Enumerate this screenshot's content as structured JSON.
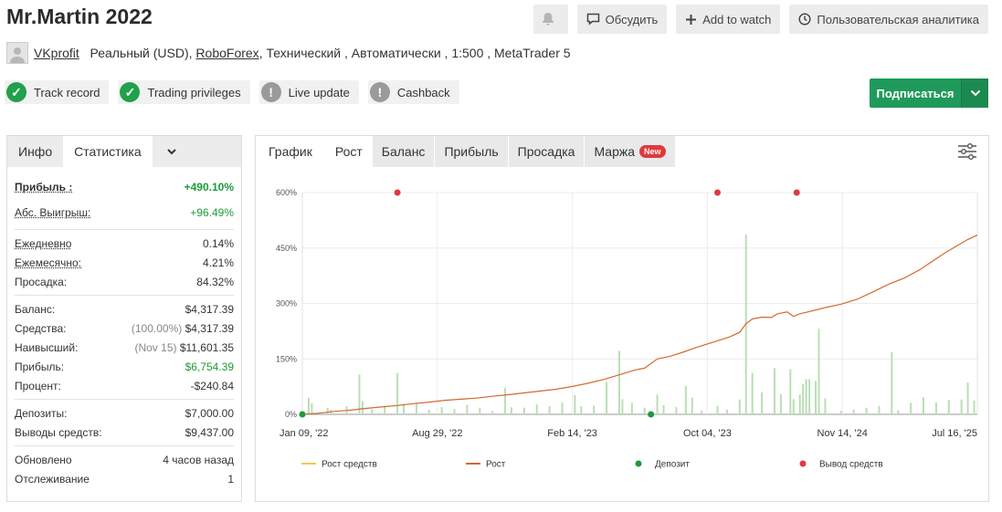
{
  "header": {
    "title": "Mr.Martin 2022",
    "discuss_label": "Обсудить",
    "watch_label": "Add to watch",
    "analytics_label": "Пользовательская аналитика"
  },
  "meta": {
    "user": "VKprofit",
    "account_type": "Реальный (USD),",
    "broker": "RoboForex",
    "rest": ", Технический , Автоматически , 1:500 , MetaTrader 5"
  },
  "badges": [
    {
      "label": "Track record",
      "status": "ok"
    },
    {
      "label": "Trading privileges",
      "status": "ok"
    },
    {
      "label": "Live update",
      "status": "warn"
    },
    {
      "label": "Cashback",
      "status": "warn"
    }
  ],
  "subscribe_label": "Подписаться",
  "left_tabs": {
    "info": "Инфо",
    "stats": "Статистика"
  },
  "stats": {
    "gain_k": "Прибыль :",
    "gain_v": "+490.10%",
    "abs_k": "Абс. Выигрыш:",
    "abs_v": "+96.49%",
    "daily_k": "Ежедневно",
    "daily_v": "0.14%",
    "monthly_k": "Ежемесячно:",
    "monthly_v": "4.21%",
    "dd_k": "Просадка:",
    "dd_v": "84.32%",
    "balance_k": "Баланс:",
    "balance_v": "$4,317.39",
    "equity_k": "Средства:",
    "equity_pct": "(100.00%)",
    "equity_v": "$4,317.39",
    "highest_k": "Наивысший:",
    "highest_date": "(Nov 15)",
    "highest_v": "$11,601.35",
    "profit_k": "Прибыль:",
    "profit_v": "$6,754.39",
    "interest_k": "Процент:",
    "interest_v": "-$240.84",
    "deposits_k": "Депозиты:",
    "deposits_v": "$7,000.00",
    "withdrawals_k": "Выводы средств:",
    "withdrawals_v": "$9,437.00",
    "updated_k": "Обновлено",
    "updated_v": "4 часов назад",
    "tracking_k": "Отслеживание",
    "tracking_v": "1"
  },
  "chart_tabs": {
    "chart": "График",
    "growth": "Рост",
    "balance": "Баланс",
    "profit": "Прибыль",
    "drawdown": "Просадка",
    "margin": "Маржа",
    "new": "New"
  },
  "chart_data": {
    "type": "line",
    "y_ticks": [
      "0%",
      "150%",
      "300%",
      "450%",
      "600%"
    ],
    "ylim": [
      0,
      600
    ],
    "x_ticks": [
      "Jan 09, '22",
      "Aug 29, '22",
      "Feb 14, '23",
      "Oct 04, '23",
      "Nov 14, '24",
      "Jul 16, '25"
    ],
    "grid": true,
    "legend_position": "bottom",
    "series": [
      {
        "name": "Рост",
        "color": "#d2692e",
        "points": [
          [
            0,
            0
          ],
          [
            5,
            3
          ],
          [
            10,
            8
          ],
          [
            15,
            11
          ],
          [
            20,
            16
          ],
          [
            25,
            20
          ],
          [
            30,
            24
          ],
          [
            35,
            29
          ],
          [
            40,
            33
          ],
          [
            45,
            38
          ],
          [
            50,
            41
          ],
          [
            55,
            44
          ],
          [
            60,
            49
          ],
          [
            65,
            53
          ],
          [
            70,
            58
          ],
          [
            75,
            63
          ],
          [
            80,
            68
          ],
          [
            85,
            75
          ],
          [
            90,
            84
          ],
          [
            95,
            94
          ],
          [
            100,
            107
          ],
          [
            105,
            120
          ],
          [
            108,
            125
          ],
          [
            112,
            150
          ],
          [
            116,
            157
          ],
          [
            120,
            168
          ],
          [
            125,
            183
          ],
          [
            130,
            196
          ],
          [
            135,
            210
          ],
          [
            138,
            222
          ],
          [
            140,
            245
          ],
          [
            142,
            258
          ],
          [
            145,
            263
          ],
          [
            148,
            262
          ],
          [
            150,
            272
          ],
          [
            153,
            277
          ],
          [
            155,
            265
          ],
          [
            157,
            272
          ],
          [
            160,
            278
          ],
          [
            165,
            289
          ],
          [
            170,
            298
          ],
          [
            175,
            311
          ],
          [
            180,
            331
          ],
          [
            185,
            352
          ],
          [
            190,
            369
          ],
          [
            195,
            392
          ],
          [
            200,
            421
          ],
          [
            203,
            438
          ],
          [
            206,
            453
          ],
          [
            210,
            473
          ],
          [
            213,
            485
          ]
        ]
      },
      {
        "name": "Рост средств",
        "color": "#f2c94c",
        "points": []
      }
    ],
    "bars": [
      [
        2,
        45
      ],
      [
        3,
        30
      ],
      [
        8,
        18
      ],
      [
        9,
        12
      ],
      [
        14,
        22
      ],
      [
        18,
        108
      ],
      [
        19,
        36
      ],
      [
        22,
        14
      ],
      [
        26,
        23
      ],
      [
        30,
        112
      ],
      [
        32,
        28
      ],
      [
        36,
        32
      ],
      [
        40,
        12
      ],
      [
        44,
        20
      ],
      [
        48,
        14
      ],
      [
        52,
        26
      ],
      [
        56,
        18
      ],
      [
        60,
        9
      ],
      [
        64,
        72
      ],
      [
        66,
        19
      ],
      [
        70,
        18
      ],
      [
        74,
        27
      ],
      [
        78,
        22
      ],
      [
        82,
        32
      ],
      [
        86,
        52
      ],
      [
        88,
        22
      ],
      [
        92,
        24
      ],
      [
        96,
        88
      ],
      [
        100,
        172
      ],
      [
        101,
        41
      ],
      [
        104,
        31
      ],
      [
        108,
        18
      ],
      [
        112,
        54
      ],
      [
        114,
        25
      ],
      [
        118,
        20
      ],
      [
        121,
        77
      ],
      [
        123,
        46
      ],
      [
        126,
        10
      ],
      [
        131,
        23
      ],
      [
        134,
        13
      ],
      [
        138,
        40
      ],
      [
        140,
        487
      ],
      [
        142,
        112
      ],
      [
        145,
        59
      ],
      [
        149,
        125
      ],
      [
        151,
        55
      ],
      [
        154,
        122
      ],
      [
        155,
        41
      ],
      [
        157,
        54
      ],
      [
        158,
        82
      ],
      [
        159,
        95
      ],
      [
        160,
        95
      ],
      [
        162,
        90
      ],
      [
        163,
        232
      ],
      [
        165,
        43
      ],
      [
        170,
        9
      ],
      [
        174,
        13
      ],
      [
        178,
        18
      ],
      [
        182,
        23
      ],
      [
        186,
        169
      ],
      [
        188,
        11
      ],
      [
        192,
        31
      ],
      [
        196,
        46
      ],
      [
        200,
        32
      ],
      [
        204,
        39
      ],
      [
        208,
        40
      ],
      [
        210,
        86
      ],
      [
        212,
        37
      ]
    ],
    "deposits": [
      [
        0,
        0
      ],
      [
        110,
        0
      ]
    ],
    "withdrawals": [
      [
        30,
        600
      ],
      [
        131,
        600
      ],
      [
        156,
        600
      ]
    ],
    "legend": [
      "Рост средств",
      "Рост",
      "Депозит",
      "Вывод средств"
    ],
    "colors": {
      "equity": "#f2c94c",
      "growth": "#d2692e",
      "deposit": "#1e9a3a",
      "withdrawal": "#e0393e",
      "bar": "#b9dfb3"
    }
  }
}
